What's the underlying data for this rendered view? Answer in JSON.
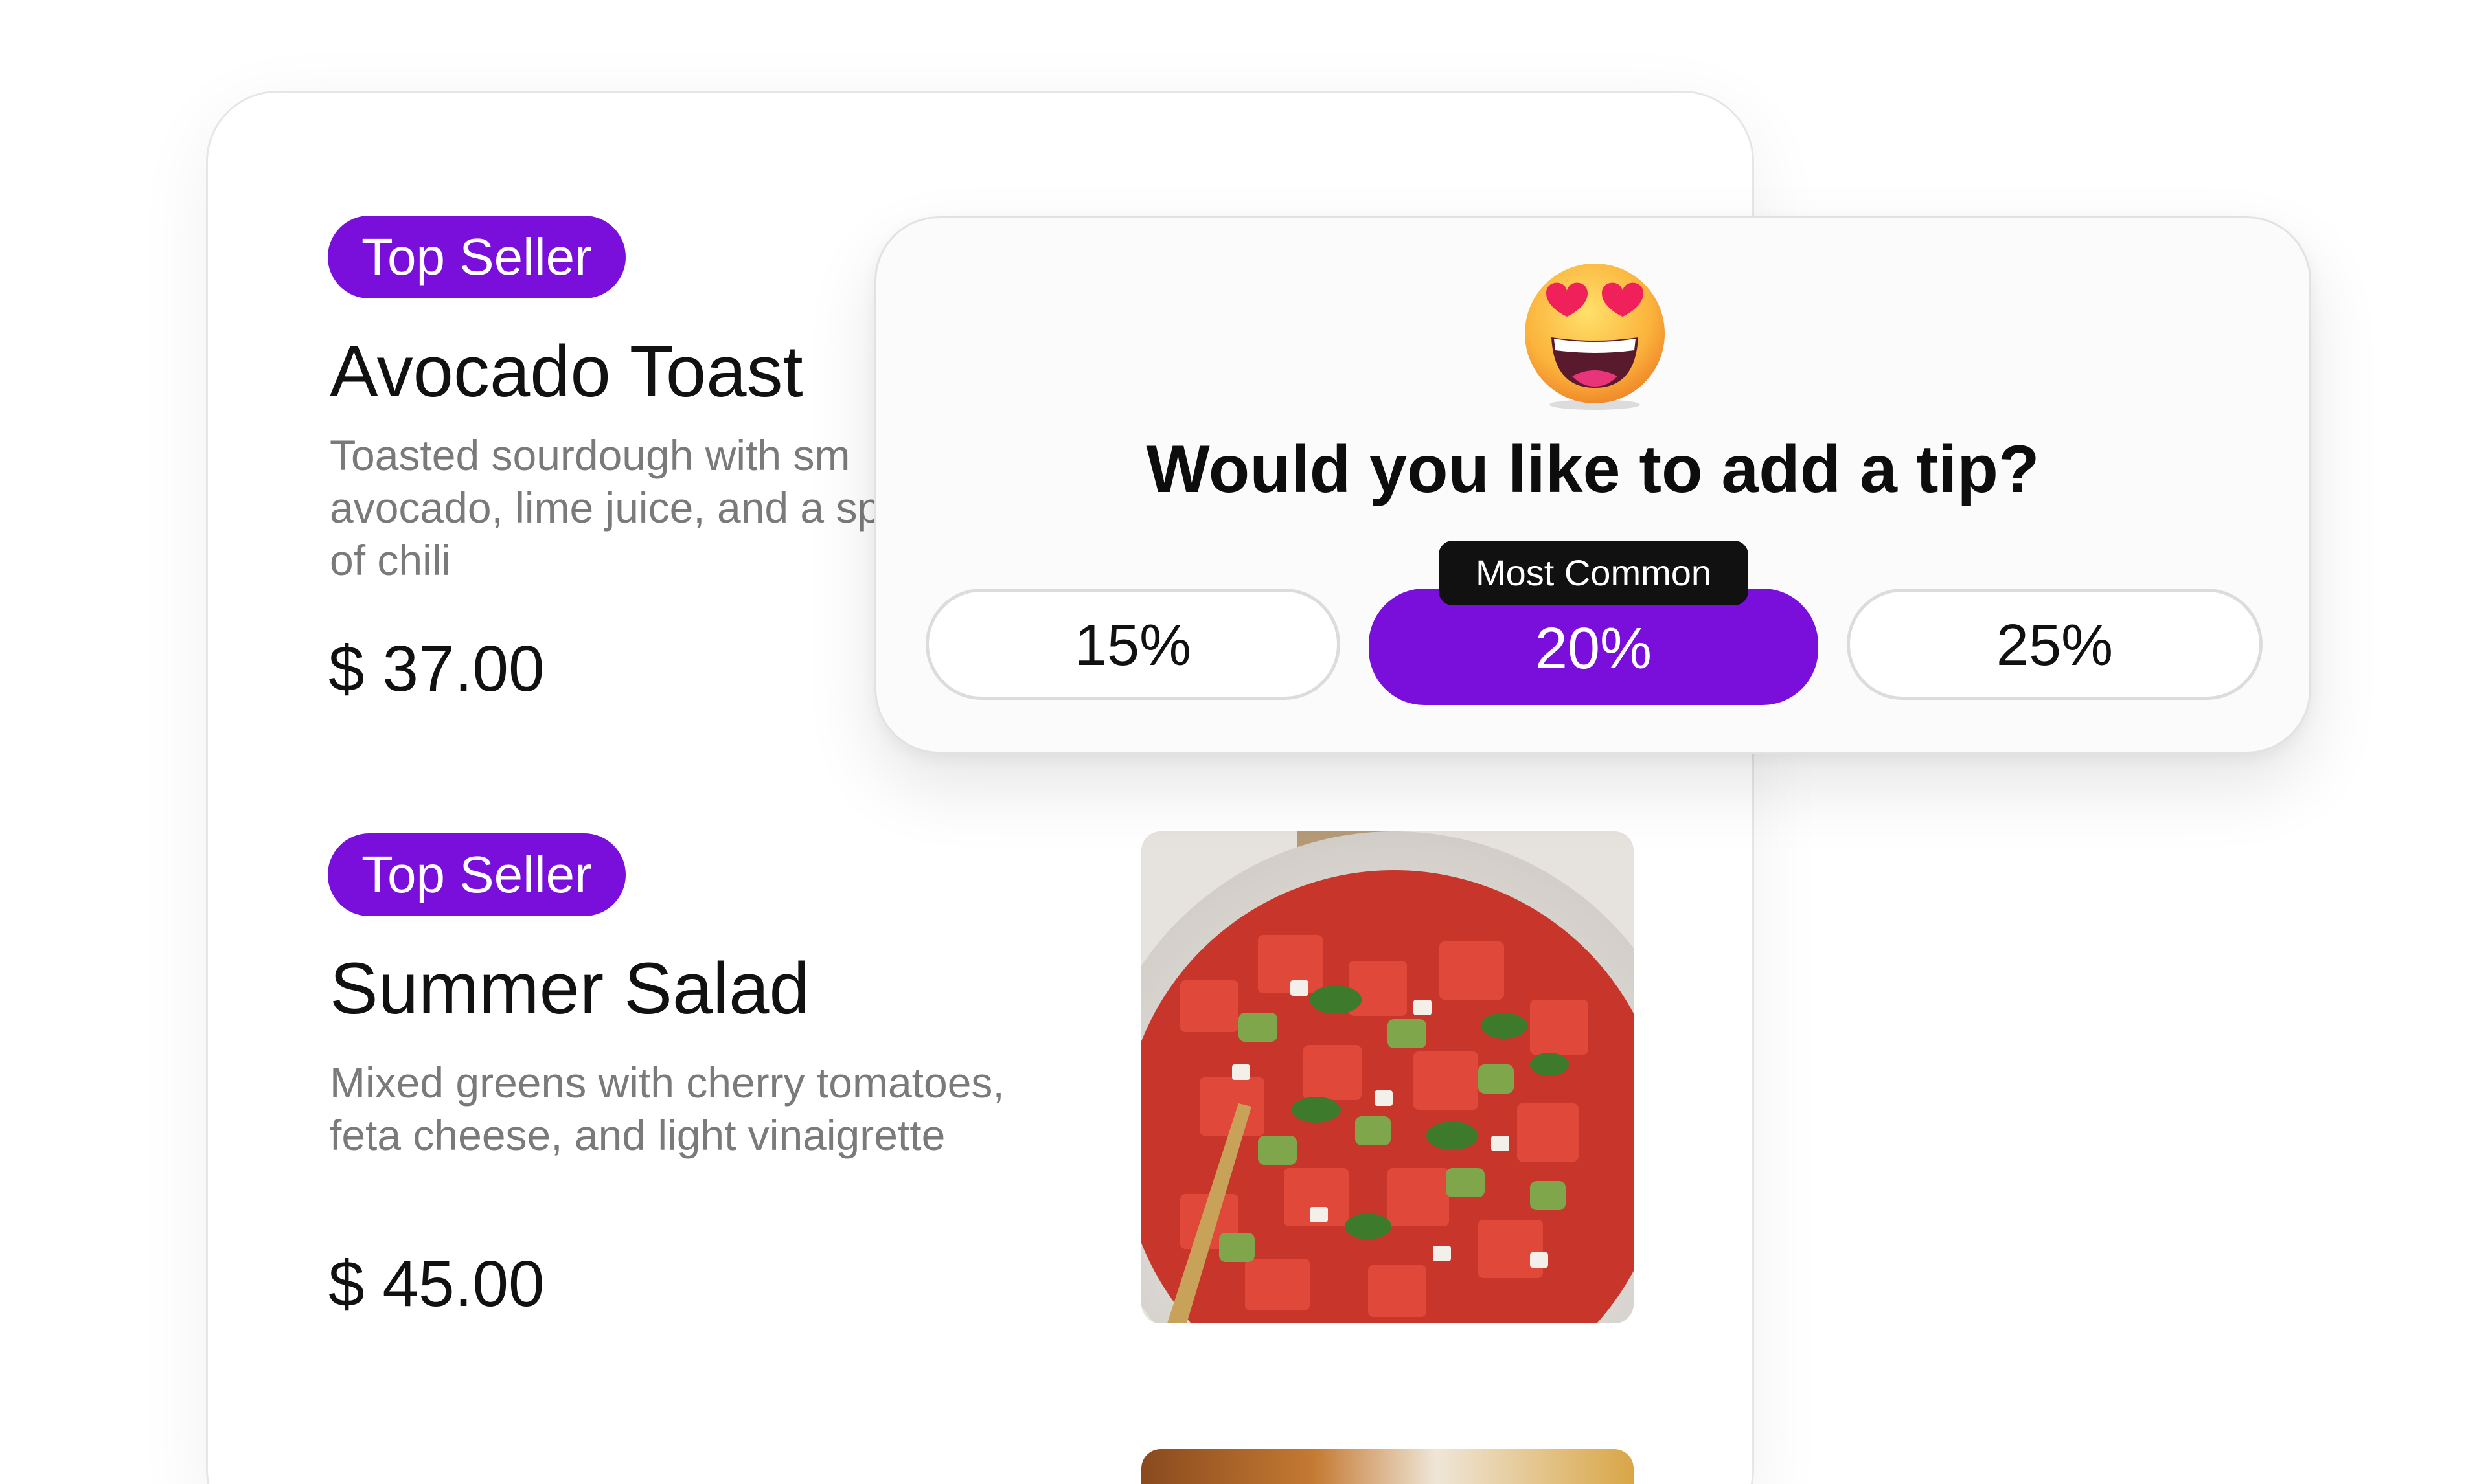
{
  "menu": {
    "items": [
      {
        "badge": "Top Seller",
        "title": "Avocado Toast",
        "desc_line1": "Toasted sourdough with sm",
        "desc_line2": "avocado, lime juice, and a sp",
        "desc_line3": "of chili",
        "price": "$ 37.00"
      },
      {
        "badge": "Top Seller",
        "title": "Summer Salad",
        "desc_line1": "Mixed greens with cherry tomatoes,",
        "desc_line2": "feta cheese, and light vinaigrette",
        "price": "$ 45.00"
      }
    ]
  },
  "tip": {
    "emoji": "heart-eyes-emoji",
    "title": "Would you like to add a tip?",
    "tooltip": "Most Common",
    "options": [
      "15%",
      "20%",
      "25%"
    ],
    "selected": "20%"
  },
  "colors": {
    "accent": "#7a0fdc",
    "tooltip_bg": "#111111",
    "text_primary": "#111111",
    "text_secondary": "#7a7a7a"
  }
}
